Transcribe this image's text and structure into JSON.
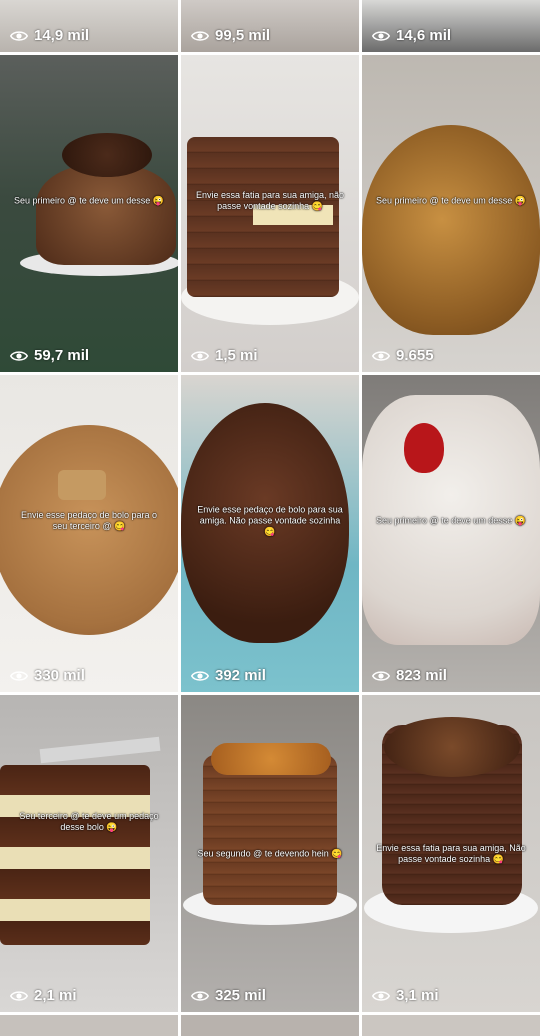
{
  "top_row": [
    {
      "views": "14,9 mil"
    },
    {
      "views": "99,5 mil"
    },
    {
      "views": "14,6 mil"
    }
  ],
  "videos": [
    {
      "caption": "Seu primeiro @ te deve um desse 😜",
      "views": "59,7 mil"
    },
    {
      "caption": "Envie essa fatia para sua amiga, não passe vontade sozinha 😋",
      "views": "1,5 mi"
    },
    {
      "caption": "Seu primeiro @ te deve um desse 😜",
      "views": "9.655"
    },
    {
      "caption": "Envie esse pedaço de bolo para o seu terceiro @ 😋",
      "views": "330 mil"
    },
    {
      "caption": "Envie esse pedaço de bolo para sua amiga. Não passe vontade sozinha 😋",
      "views": "392 mil"
    },
    {
      "caption": "Seu primeiro @ te deve um desse 😜",
      "views": "823 mil"
    },
    {
      "caption": "Seu terceiro @ te deve um pedaço desse bolo 😜",
      "views": "2,1 mi"
    },
    {
      "caption": "Seu segundo @ te devendo hein 😋",
      "views": "325 mil"
    },
    {
      "caption": "Envie essa fatia para sua amiga, Não passe vontade sozinha 😋",
      "views": "3,1 mi"
    }
  ],
  "icons": {
    "views_icon": "eye-icon"
  },
  "colors": {
    "text": "#ffffff",
    "chocolate": "#5a3220",
    "crumble": "#b9834a",
    "coconut": "#e6e1dc"
  }
}
